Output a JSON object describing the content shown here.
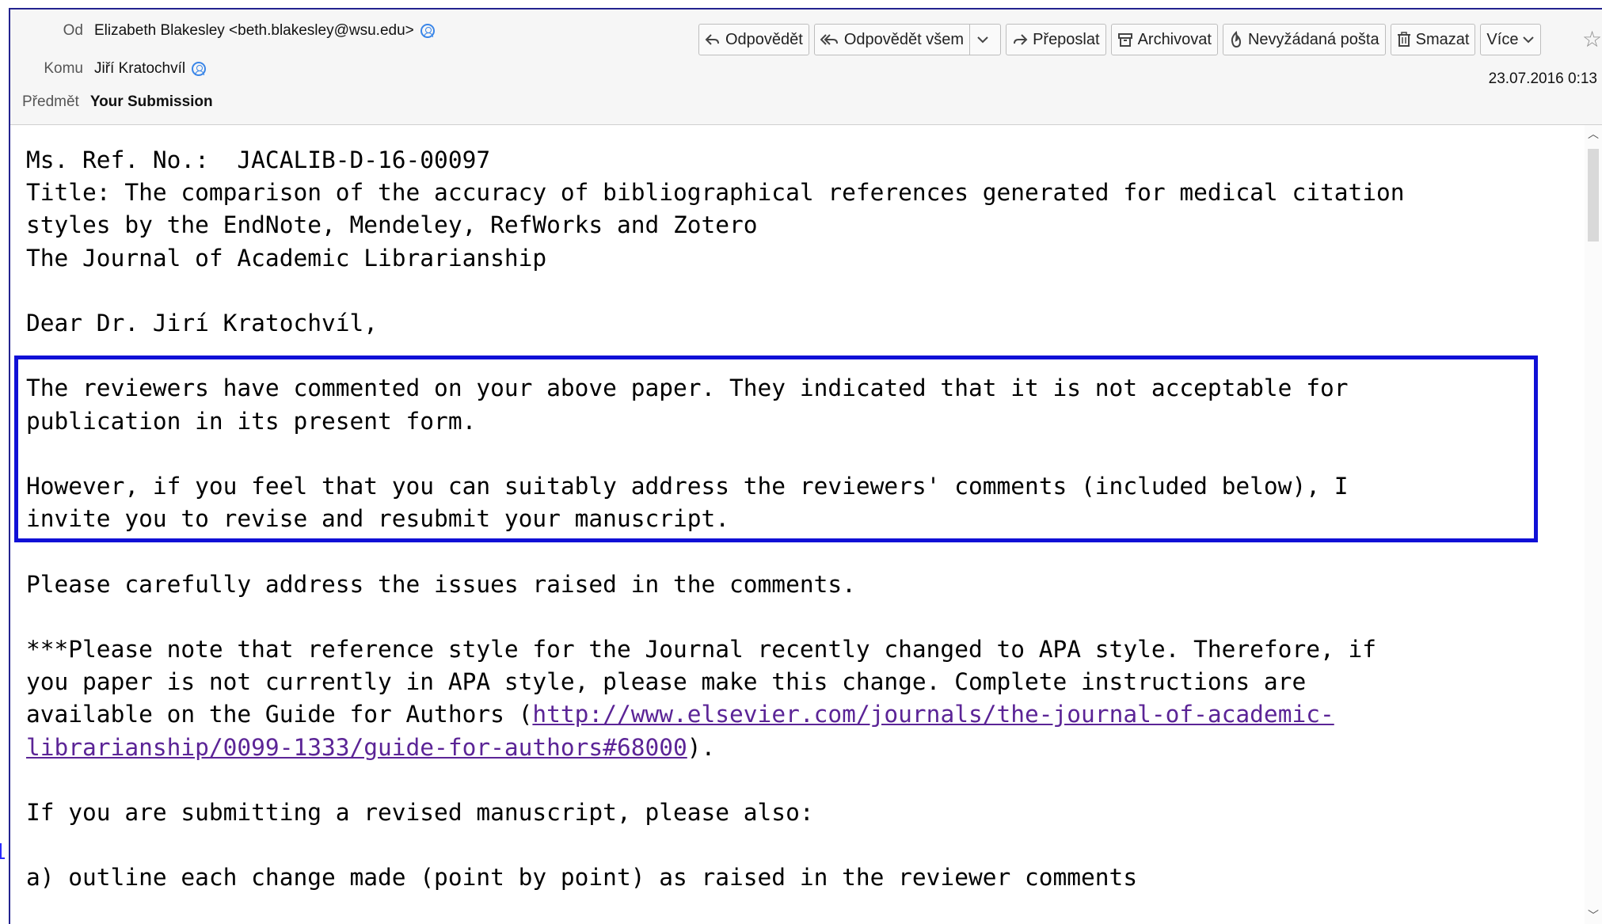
{
  "header": {
    "from_label": "Od",
    "from_value": "Elizabeth Blakesley <beth.blakesley@wsu.edu>",
    "to_label": "Komu",
    "to_value": "Jiří Kratochvíl",
    "subject_label": "Předmět",
    "subject_value": "Your Submission",
    "date": "23.07.2016 0:13"
  },
  "toolbar": {
    "reply": "Odpovědět",
    "reply_all": "Odpovědět všem",
    "forward": "Přeposlat",
    "archive": "Archivovat",
    "junk": "Nevyžádaná pošta",
    "delete": "Smazat",
    "more": "Více"
  },
  "icons": [
    "reply-icon",
    "reply-all-icon",
    "forward-icon",
    "archive-icon",
    "junk-icon",
    "trash-icon",
    "chevron-down-icon",
    "star-icon",
    "contact-icon"
  ],
  "message": {
    "ref": "Ms. Ref. No.:  JACALIB-D-16-00097",
    "title1": "Title: The comparison of the accuracy of bibliographical references generated for medical citation",
    "title2": "styles by the EndNote, Mendeley, RefWorks and Zotero",
    "journal": "The Journal of Academic Librarianship",
    "greeting": "Dear Dr. Jirí Kratochvíl,",
    "p1a": "The reviewers have commented on your above paper. They indicated that it is not acceptable for",
    "p1b": "publication in its present form.",
    "p2a": "However, if you feel that you can suitably address the reviewers' comments (included below), I",
    "p2b": "invite you to revise and resubmit your manuscript.",
    "p3": "Please carefully address the issues raised in the comments.",
    "p4a": "***Please note that reference style for the Journal recently changed to APA style. Therefore, if",
    "p4b": "you paper is not currently in APA style, please make this change. Complete instructions are",
    "p4c_pre": "available on the Guide for Authors (",
    "link1": "http://www.elsevier.com/journals/the-journal-of-academic-",
    "link2": "librarianship/0099-1333/guide-for-authors#68000",
    "p4d_post": ").",
    "p5": "If you are submitting a revised manuscript, please also:",
    "p6": "a) outline each change made (point by point) as raised in the reviewer comments"
  },
  "colors": {
    "highlight_border": "#1010d6",
    "link": "#5b2496",
    "header_bg": "#f6f6f6"
  }
}
